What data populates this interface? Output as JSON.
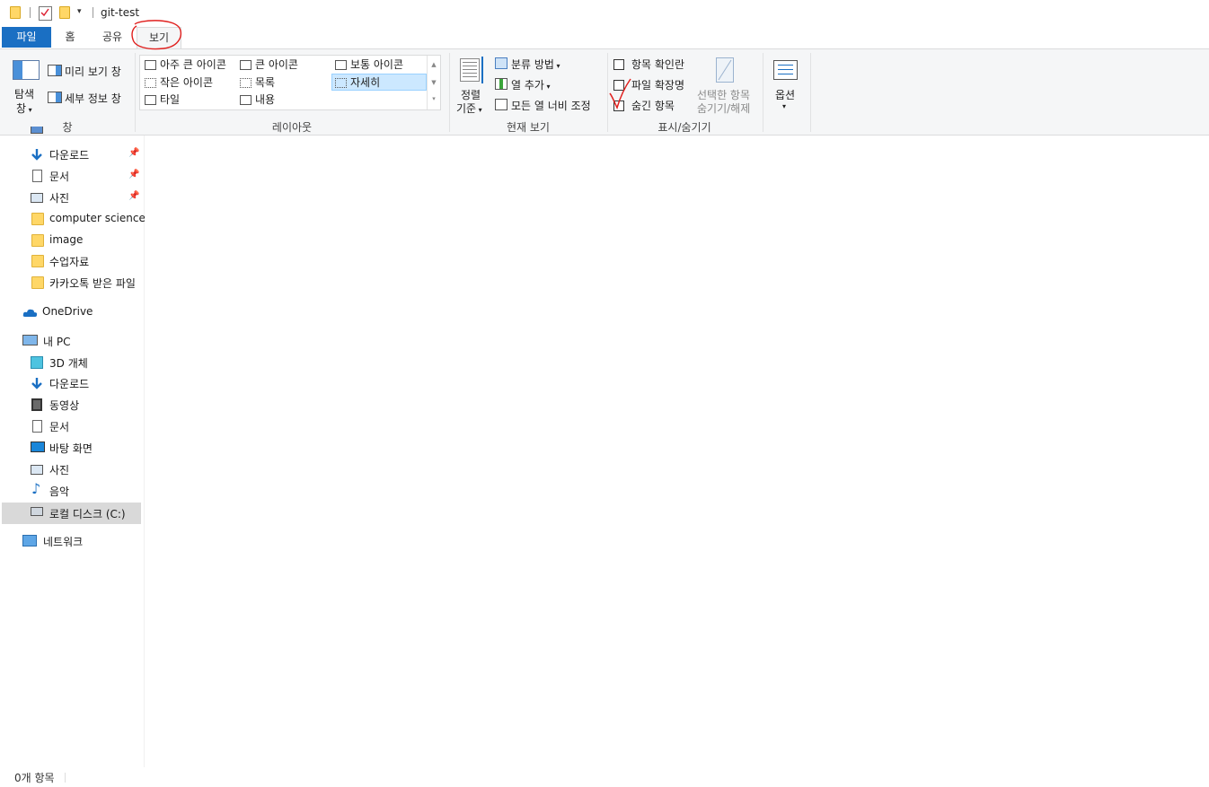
{
  "title_bar": {
    "title": "git-test",
    "customize_caret": "▾"
  },
  "tabs": [
    {
      "label": "파일"
    },
    {
      "label": "홈"
    },
    {
      "label": "공유"
    },
    {
      "label": "보기"
    }
  ],
  "ribbon": {
    "pane_group": {
      "nav_pane_line1": "탐색",
      "nav_pane_line2": "창",
      "preview_pane": "미리 보기 창",
      "details_pane": "세부 정보 창",
      "label": "창"
    },
    "layout_group": {
      "items": [
        "아주 큰 아이콘",
        "큰 아이콘",
        "보통 아이콘",
        "작은 아이콘",
        "목록",
        "자세히",
        "타일",
        "내용"
      ],
      "label": "레이아웃"
    },
    "current_view_group": {
      "sort_line1": "정렬",
      "sort_line2": "기준",
      "group_by": "분류 방법",
      "add_columns": "열 추가",
      "fit_columns": "모든 열 너비 조정",
      "label": "현재 보기"
    },
    "show_hide_group": {
      "item_checkboxes": "항목 확인란",
      "file_extensions": "파일 확장명",
      "hidden_items": "숨긴 항목",
      "hide_selected_line1": "선택한 항목",
      "hide_selected_line2": "숨기기/해제",
      "label": "표시/숨기기"
    },
    "options": {
      "label": "옵션"
    }
  },
  "nav": {
    "quick_access": [
      {
        "label": "다운로드",
        "icon": "download-arrow-icon"
      },
      {
        "label": "문서",
        "icon": "document-icon"
      },
      {
        "label": "사진",
        "icon": "pictures-icon"
      },
      {
        "label": "computer science",
        "icon": "folder-icon"
      },
      {
        "label": "image",
        "icon": "folder-icon"
      },
      {
        "label": "수업자료",
        "icon": "folder-icon"
      },
      {
        "label": "카카오톡 받은 파일",
        "icon": "folder-icon"
      }
    ],
    "onedrive": "OneDrive",
    "this_pc": "내 PC",
    "pc_items": [
      {
        "label": "3D 개체",
        "icon": "3d-objects-icon"
      },
      {
        "label": "다운로드",
        "icon": "download-arrow-icon"
      },
      {
        "label": "동영상",
        "icon": "video-icon"
      },
      {
        "label": "문서",
        "icon": "document-icon"
      },
      {
        "label": "바탕 화면",
        "icon": "desktop-icon"
      },
      {
        "label": "사진",
        "icon": "pictures-icon"
      },
      {
        "label": "음악",
        "icon": "music-icon"
      },
      {
        "label": "로컬 디스크 (C:)",
        "icon": "drive-icon"
      }
    ],
    "network": "네트워크"
  },
  "status": {
    "item_count": "0개 항목"
  },
  "colors": {
    "file_tab": "#1a6fc3",
    "annotation": "#e0201e",
    "selection": "#cce8ff"
  }
}
